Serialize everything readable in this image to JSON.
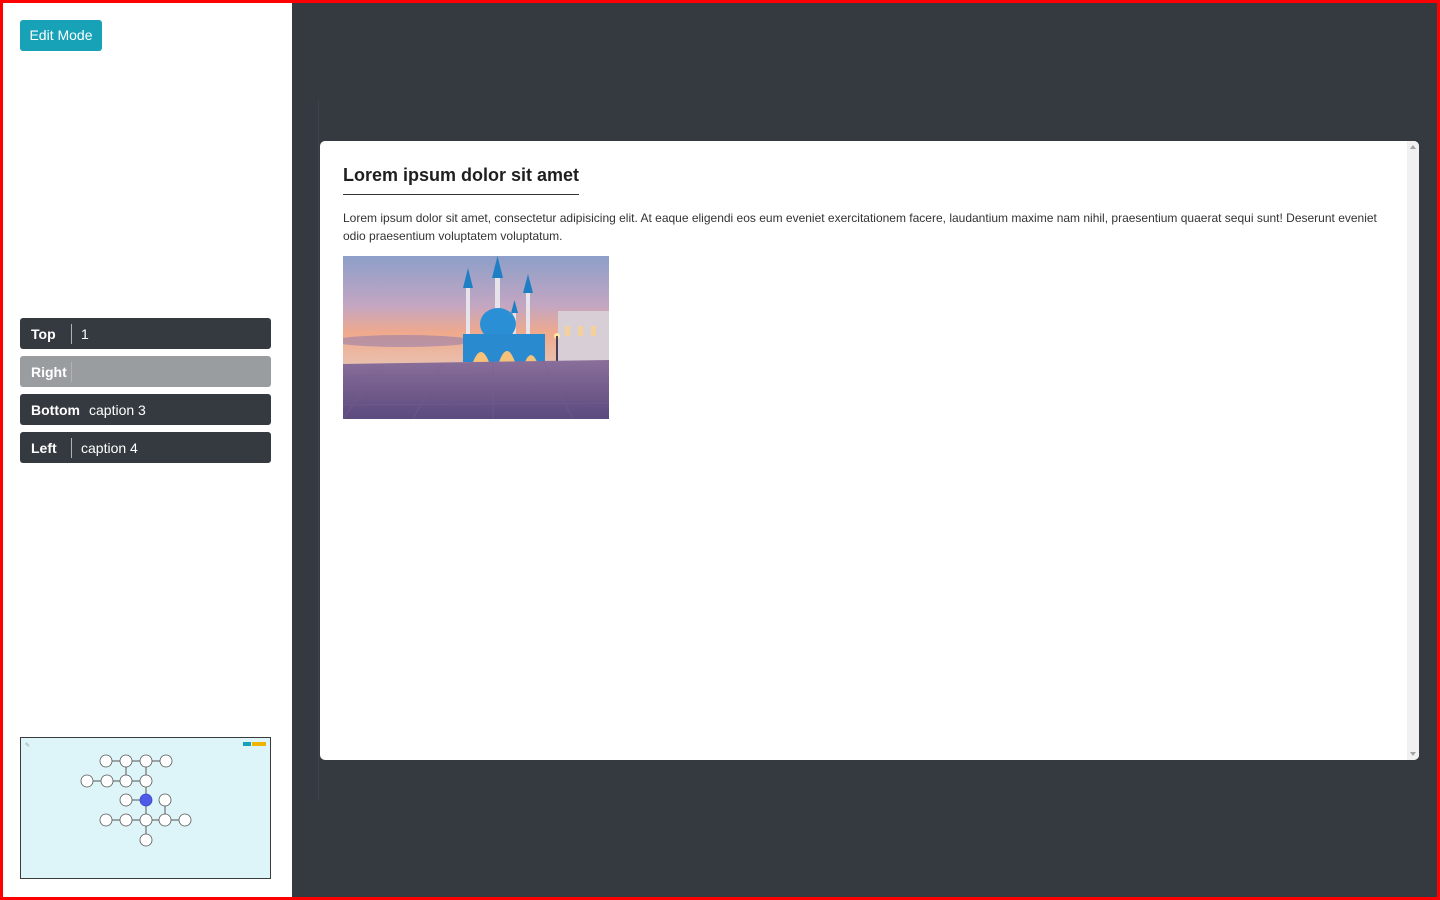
{
  "toolbar": {
    "edit_mode_label": "Edit Mode"
  },
  "captions": [
    {
      "label": "Top",
      "value": "1",
      "enabled": true
    },
    {
      "label": "Right",
      "value": "",
      "enabled": false
    },
    {
      "label": "Bottom",
      "value": "caption 3",
      "enabled": true
    },
    {
      "label": "Left",
      "value": "caption 4",
      "enabled": true
    }
  ],
  "content": {
    "title": "Lorem ipsum dolor sit amet",
    "body": "Lorem ipsum dolor sit amet, consectetur adipisicing elit. At eaque eligendi eos eum eveniet exercitationem facere, laudantium maxime nam nihil, praesentium quaerat sequi sunt! Deserunt eveniet odio praesentium voluptatem voluptatum."
  },
  "colors": {
    "accent": "#17a2b8",
    "dark": "#343a40",
    "disabled": "#9a9da0",
    "minimap_bg": "#ddf5f8",
    "active_node": "#4f5be8",
    "frame": "#ff0000"
  },
  "icons": {
    "scroll_up": "scroll-up-arrow-icon",
    "scroll_down": "scroll-down-arrow-icon"
  }
}
